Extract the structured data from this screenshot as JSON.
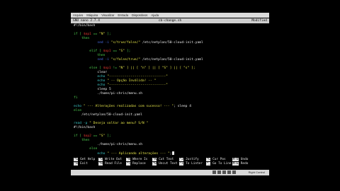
{
  "menubar": {
    "items": [
      "Arquivo",
      "Máquina",
      "Visualizar",
      "Entrada",
      "Dispositivos",
      "Ajuda"
    ]
  },
  "titlebar": {
    "left": "GNU nano 2.7.4",
    "center": "cb-change.sh",
    "right": "Modified"
  },
  "editor": {
    "lines": [
      {
        "indent": 0,
        "parts": [
          {
            "t": "#!/bin/bash",
            "c": "wht"
          }
        ]
      },
      {
        "indent": 0,
        "parts": [
          {
            "t": "",
            "c": ""
          }
        ]
      },
      {
        "indent": 0,
        "parts": [
          {
            "t": "if [ ",
            "c": "grn"
          },
          {
            "t": "$op1",
            "c": "red"
          },
          {
            "t": " == ",
            "c": "grn"
          },
          {
            "t": "\"N\"",
            "c": "yel"
          },
          {
            "t": " ]; ",
            "c": "grn"
          }
        ]
      },
      {
        "indent": 2,
        "parts": [
          {
            "t": "then",
            "c": "grn"
          }
        ]
      },
      {
        "indent": 6,
        "parts": [
          {
            "t": "sed -i ",
            "c": "blu"
          },
          {
            "t": "\"s/true/false/\"",
            "c": "yel"
          },
          {
            "t": " /etc/netplan/50-cloud-init.yaml",
            "c": "wht"
          }
        ]
      },
      {
        "indent": 0,
        "parts": [
          {
            "t": "",
            "c": ""
          }
        ]
      },
      {
        "indent": 4,
        "parts": [
          {
            "t": "elif [ ",
            "c": "grn"
          },
          {
            "t": "$op1",
            "c": "red"
          },
          {
            "t": " == ",
            "c": "grn"
          },
          {
            "t": "\"S\"",
            "c": "yel"
          },
          {
            "t": " ];",
            "c": "grn"
          }
        ]
      },
      {
        "indent": 6,
        "parts": [
          {
            "t": "then",
            "c": "grn"
          }
        ]
      },
      {
        "indent": 6,
        "parts": [
          {
            "t": "sed -i ",
            "c": "blu"
          },
          {
            "t": "\"s/false/true/\"",
            "c": "yel"
          },
          {
            "t": " /etc/netplan/50-cloud-init.yaml",
            "c": "wht"
          }
        ]
      },
      {
        "indent": 0,
        "parts": [
          {
            "t": "",
            "c": ""
          }
        ]
      },
      {
        "indent": 4,
        "parts": [
          {
            "t": "else [ ",
            "c": "grn"
          },
          {
            "t": "$op1",
            "c": "red"
          },
          {
            "t": " != ",
            "c": "grn"
          },
          {
            "t": "\"N\" ] || [ \"n\" ] || [ \"S\" ] || [ \"s\" ];",
            "c": "yel"
          }
        ]
      },
      {
        "indent": 6,
        "parts": [
          {
            "t": "clear",
            "c": "wht"
          }
        ]
      },
      {
        "indent": 6,
        "parts": [
          {
            "t": "echo ",
            "c": "cyn"
          },
          {
            "t": "\"-----------------------------\"",
            "c": "yel"
          }
        ]
      },
      {
        "indent": 6,
        "parts": [
          {
            "t": "echo ",
            "c": "cyn"
          },
          {
            "t": "\" -- Opção Inválida! -- \"",
            "c": "yel"
          }
        ]
      },
      {
        "indent": 6,
        "parts": [
          {
            "t": "echo ",
            "c": "cyn"
          },
          {
            "t": "\"-----------------------------\"",
            "c": "yel"
          }
        ]
      },
      {
        "indent": 6,
        "parts": [
          {
            "t": "sleep 5",
            "c": "wht"
          }
        ]
      },
      {
        "indent": 6,
        "parts": [
          {
            "t": "./home/pi-chris/menu.sh",
            "c": "wht"
          }
        ]
      },
      {
        "indent": 0,
        "parts": [
          {
            "t": "fi",
            "c": "grn"
          }
        ]
      },
      {
        "indent": 0,
        "parts": [
          {
            "t": "",
            "c": ""
          }
        ]
      },
      {
        "indent": 0,
        "parts": [
          {
            "t": "echo ",
            "c": "cyn"
          },
          {
            "t": "\" --- Alterações realizadas com sucesso! --- \"",
            "c": "yel"
          },
          {
            "t": "; sleep 4",
            "c": "wht"
          }
        ]
      },
      {
        "indent": 0,
        "parts": [
          {
            "t": "else",
            "c": "grn"
          }
        ]
      },
      {
        "indent": 2,
        "parts": [
          {
            "t": "/etc/netplan/50-cloud-init.yaml",
            "c": "wht"
          }
        ]
      },
      {
        "indent": 0,
        "parts": [
          {
            "t": "",
            "c": ""
          }
        ]
      },
      {
        "indent": 0,
        "parts": [
          {
            "t": "read -p ",
            "c": "cyn"
          },
          {
            "t": "\" Deseja voltar ao menu? S/N \"",
            "c": "yel"
          }
        ]
      },
      {
        "indent": 0,
        "parts": [
          {
            "t": "#!/bin/bash",
            "c": "wht"
          }
        ]
      },
      {
        "indent": 0,
        "parts": [
          {
            "t": "",
            "c": ""
          }
        ]
      },
      {
        "indent": 0,
        "parts": [
          {
            "t": "if [ ",
            "c": "grn"
          },
          {
            "t": "$op2",
            "c": "red"
          },
          {
            "t": " == ",
            "c": "grn"
          },
          {
            "t": "\"S\"",
            "c": "yel"
          },
          {
            "t": " ]; ",
            "c": "grn"
          }
        ]
      },
      {
        "indent": 2,
        "parts": [
          {
            "t": "then",
            "c": "grn"
          }
        ]
      },
      {
        "indent": 6,
        "parts": [
          {
            "t": "./home/pi-chris/menu.sh",
            "c": "wht"
          }
        ]
      },
      {
        "indent": 4,
        "parts": [
          {
            "t": "else",
            "c": "grn"
          }
        ]
      },
      {
        "indent": 6,
        "parts": [
          {
            "t": "echo ",
            "c": "cyn"
          },
          {
            "t": "\" --- Aplicando alterações --- \"",
            "c": "yel"
          },
          {
            "t": ";",
            "c": "wht"
          }
        ]
      }
    ]
  },
  "shortcuts": [
    {
      "key": "^G",
      "label": "Get Help"
    },
    {
      "key": "^O",
      "label": "Write Out"
    },
    {
      "key": "^W",
      "label": "Where Is"
    },
    {
      "key": "^K",
      "label": "Cut Text"
    },
    {
      "key": "^J",
      "label": "Justify"
    },
    {
      "key": "^C",
      "label": "Cur Pos"
    },
    {
      "key": "M-U",
      "label": "Undo"
    },
    {
      "key": "^X",
      "label": "Exit"
    },
    {
      "key": "^R",
      "label": "Read File"
    },
    {
      "key": "^\\",
      "label": "Replace"
    },
    {
      "key": "^U",
      "label": "Uncut Text"
    },
    {
      "key": "^T",
      "label": "To Linter"
    },
    {
      "key": "^_",
      "label": "Go To Line"
    },
    {
      "key": "M-E",
      "label": "Redo"
    }
  ],
  "taskbar": {
    "host_key": "Right Control"
  }
}
